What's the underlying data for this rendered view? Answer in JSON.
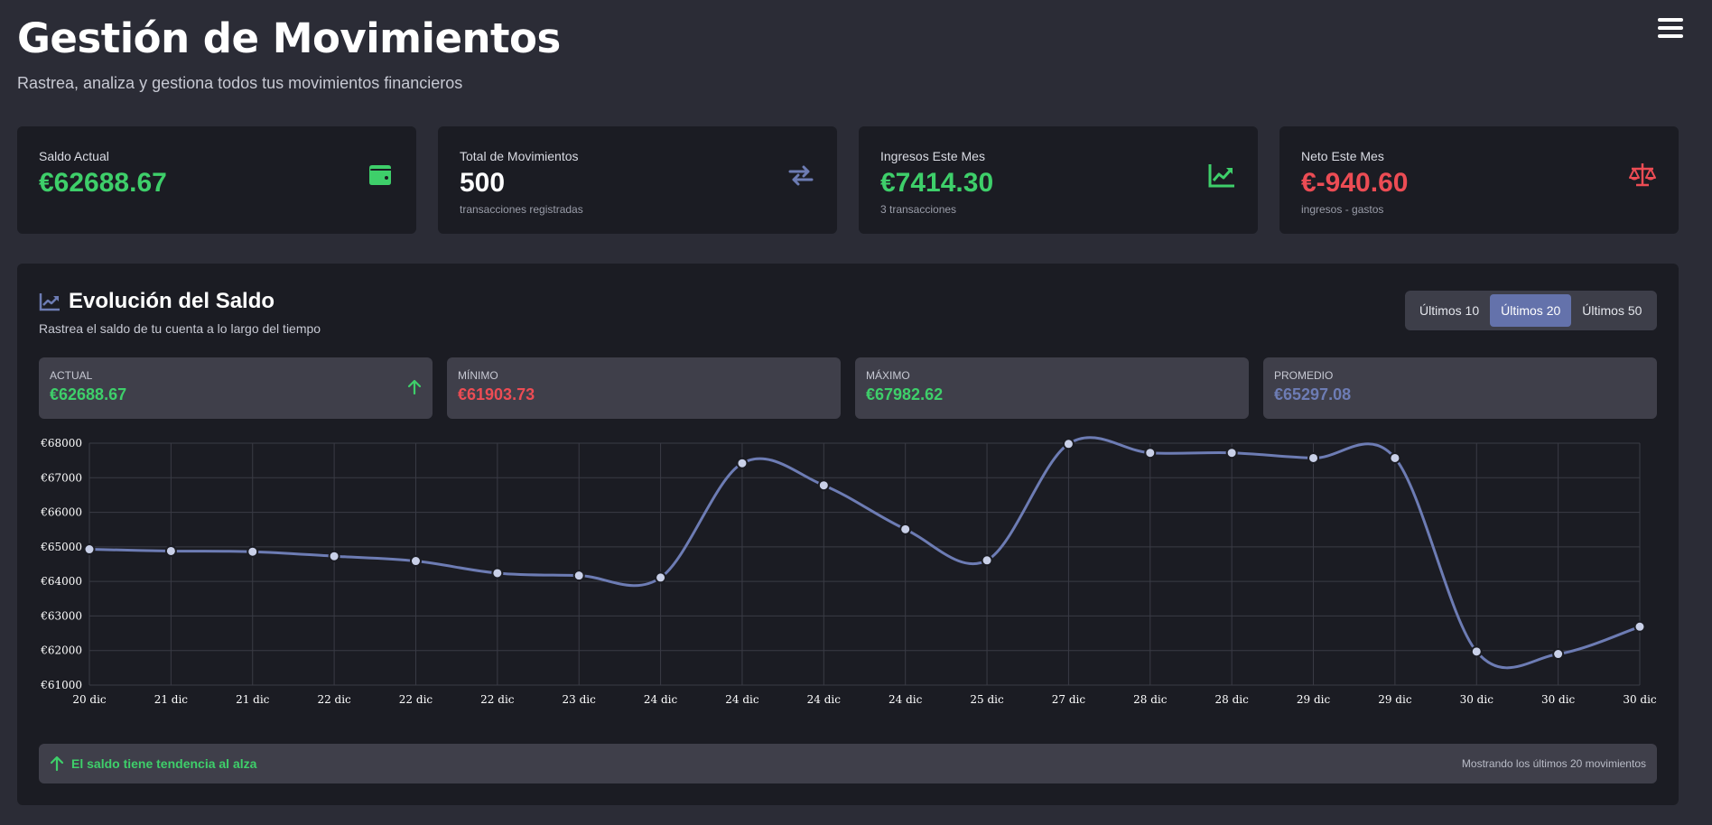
{
  "header": {
    "title": "Gestión de Movimientos",
    "subtitle": "Rastrea, analiza y gestiona todos tus movimientos financieros",
    "menu_icon": "hamburger-menu-icon"
  },
  "cards": [
    {
      "label": "Saldo Actual",
      "value": "€62688.67",
      "sub": "",
      "icon": "wallet-icon",
      "color": "#3ecf6a"
    },
    {
      "label": "Total de Movimientos",
      "value": "500",
      "sub": "transacciones registradas",
      "icon": "arrows-exchange-icon",
      "color": "#ffffff"
    },
    {
      "label": "Ingresos Este Mes",
      "value": "€7414.30",
      "sub": "3 transacciones",
      "icon": "trend-up-icon",
      "color": "#3ecf6a"
    },
    {
      "label": "Neto Este Mes",
      "value": "€-940.60",
      "sub": "ingresos - gastos",
      "icon": "balance-scale-icon",
      "color": "#ec4c54"
    }
  ],
  "panel": {
    "title": "Evolución del Saldo",
    "subtitle": "Rastrea el saldo de tu cuenta a lo largo del tiempo",
    "ranges": [
      "Últimos 10",
      "Últimos 20",
      "Últimos 50"
    ],
    "active_range": "Últimos 20",
    "stats": [
      {
        "label": "ACTUAL",
        "value": "€62688.67",
        "color": "#3ecf6a",
        "icon": "arrow-up-icon"
      },
      {
        "label": "MÍNIMO",
        "value": "€61903.73",
        "color": "#ec4c54"
      },
      {
        "label": "MÁXIMO",
        "value": "€67982.62",
        "color": "#3ecf6a"
      },
      {
        "label": "PROMEDIO",
        "value": "€65297.08",
        "color": "#6d7cb4"
      }
    ],
    "trend_text": "El saldo tiene tendencia al alza",
    "showing_text": "Mostrando los últimos 20 movimientos"
  },
  "colors": {
    "line": "#6d7cb4",
    "accent": "#6472ab",
    "green": "#3ecf6a",
    "red": "#ec4c54"
  },
  "chart_data": {
    "type": "line",
    "categories": [
      "20 dic",
      "21 dic",
      "21 dic",
      "22 dic",
      "22 dic",
      "22 dic",
      "23 dic",
      "24 dic",
      "24 dic",
      "24 dic",
      "24 dic",
      "25 dic",
      "27 dic",
      "28 dic",
      "28 dic",
      "29 dic",
      "29 dic",
      "30 dic",
      "30 dic",
      "30 dic"
    ],
    "series": [
      {
        "values": [
          64930,
          64880,
          64860,
          64730,
          64590,
          64240,
          64170,
          64110,
          67420,
          66780,
          65510,
          64610,
          67980,
          67720,
          67720,
          67570,
          67570,
          61970,
          61900,
          62690
        ]
      }
    ],
    "ylim": [
      61000,
      68000
    ],
    "yticks": [
      61000,
      62000,
      63000,
      64000,
      65000,
      66000,
      67000,
      68000
    ],
    "ytick_prefix": "€",
    "grid": true,
    "smooth": true
  }
}
